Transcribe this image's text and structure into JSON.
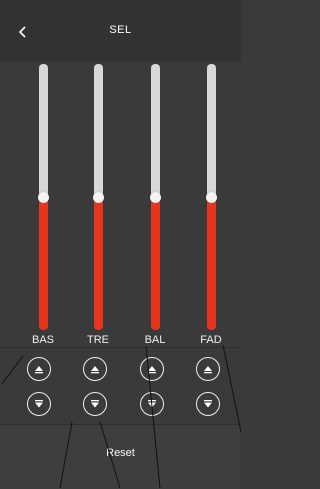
{
  "header": {
    "title": "SEL",
    "back_icon": "chevron-left-icon"
  },
  "sliders": [
    {
      "label": "BAS",
      "value": 0.5
    },
    {
      "label": "TRE",
      "value": 0.5
    },
    {
      "label": "BAL",
      "value": 0.5
    },
    {
      "label": "FAD",
      "value": 0.5
    }
  ],
  "controls": {
    "up_icon": "triangle-up-icon",
    "down_icon": "triangle-down-icon"
  },
  "footer": {
    "reset_label": "Reset"
  },
  "colors": {
    "accent": "#e7351d",
    "track": "#d8d8d8",
    "background": "#3a3a3a"
  }
}
